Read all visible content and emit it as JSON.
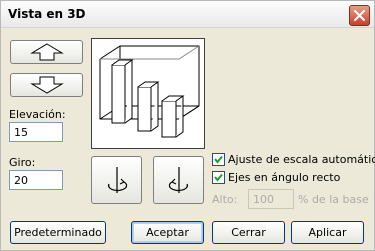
{
  "dialog": {
    "title": "Vista en 3D",
    "close_icon": "close-icon"
  },
  "elevation": {
    "label": "Elevación:",
    "value": "15"
  },
  "rotation": {
    "label": "Giro:",
    "value": "20"
  },
  "options": {
    "autoscale_label": "Ajuste de escala automático",
    "autoscale_checked": true,
    "right_angle_label": "Ejes en ángulo recto",
    "right_angle_checked": true,
    "height_label": "Alto:",
    "height_value": "100",
    "height_suffix": "% de la base"
  },
  "buttons": {
    "default_label": "Predeterminado",
    "accept_label": "Aceptar",
    "close_label": "Cerrar",
    "apply_label": "Aplicar"
  },
  "icons": {
    "up": "arrow-up-icon",
    "down": "arrow-down-icon",
    "rotate_left": "rotate-left-icon",
    "rotate_right": "rotate-right-icon",
    "preview": "bar-chart-3d-preview"
  }
}
